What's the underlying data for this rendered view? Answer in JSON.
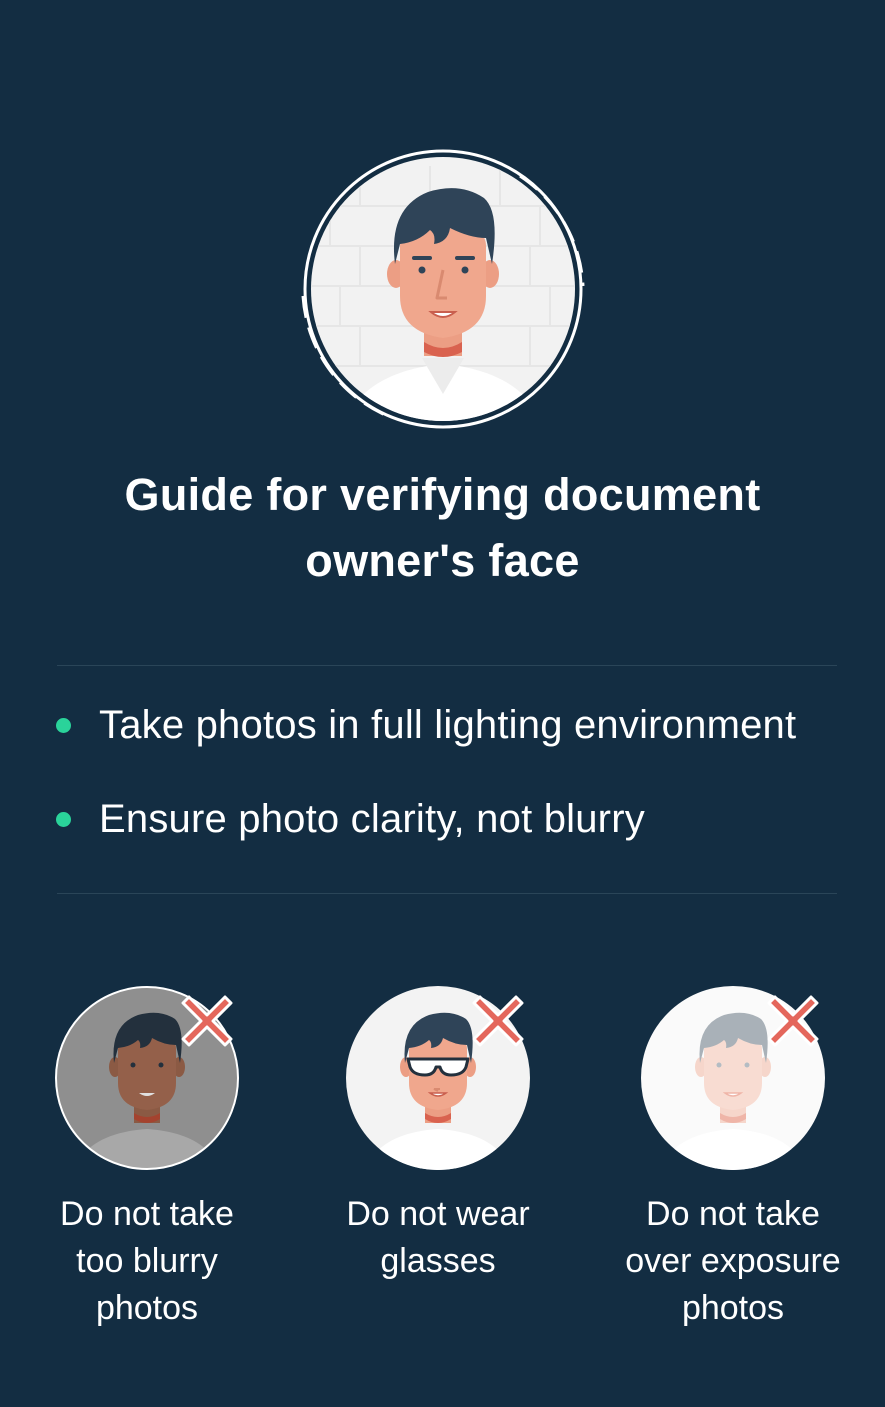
{
  "title": "Guide for verifying document owner's face",
  "tips": [
    {
      "text": "Take photos in full lighting environment",
      "bullet_color": "#2ad39a"
    },
    {
      "text": "Ensure photo clarity, not blurry",
      "bullet_color": "#2ad39a"
    }
  ],
  "examples": [
    {
      "caption": "Do not take\ntoo blurry\nphotos",
      "icon": "blurry-face-icon"
    },
    {
      "caption": "Do not wear\nglasses",
      "icon": "glasses-face-icon"
    },
    {
      "caption": "Do not take\nover exposure\nphotos",
      "icon": "overexposed-face-icon"
    }
  ],
  "colors": {
    "background": "#132d42",
    "accent": "#2ad39a",
    "reject": "#e4675c",
    "divider": "#2a4558"
  }
}
